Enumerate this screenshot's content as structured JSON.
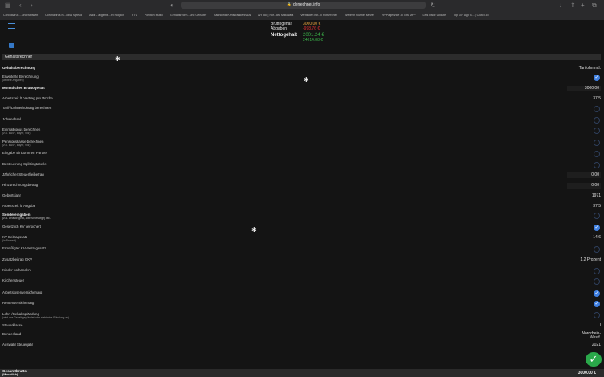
{
  "browser": {
    "url": "derrechner.info",
    "bookmarks": [
      "Coronavirus ...und weltweit",
      "Coronavirus m...lobal spread",
      "Audi – allgeme...tei möglich",
      "FTV",
      "Position Music",
      "Gehaltsrechn...und Gehälter",
      "Zahnklinik Kreiskrankenhaus",
      "Art Idol | Por...dra Makowka",
      "Verbinden mit...Il PowerShell",
      "Webmin tvusnet server",
      "HP PageWide 377dw MFP",
      "LetsTrade Update",
      "Top 10+ App B... | Clutch.co"
    ]
  },
  "summary": {
    "brutto_label": "Bruttogehalt",
    "brutto_value": "3000.00 €",
    "abgaben_label": "Abgaben",
    "abgaben_value": "-998.76 €",
    "netto_label": "Nettogehalt",
    "netto_value": "2001.24 €",
    "netto_sub": "24014.88 €",
    "colors": {
      "brutto": "#e6a23c",
      "abgaben": "#e03030",
      "netto": "#3bb34a"
    }
  },
  "section_title": "Gehaltsrechner",
  "rows": [
    {
      "label": "Gehaltsberechnung",
      "bold": true,
      "value": "Tarifohn mtl."
    },
    {
      "label": "Erweiterte Berechnung",
      "sub": "(weitere Angaben)",
      "check": true
    },
    {
      "label": "Monatliches Bruttogehalt",
      "bold": true,
      "value": "3000.00",
      "boxed": true
    },
    {
      "label": "Arbeitszeit lt. Vertrag pro Woche",
      "value": "37.5"
    },
    {
      "label": "Tarif-/Lohnerhöhung berechnen",
      "check": false
    },
    {
      "label": "Jobwechsel",
      "check": false
    },
    {
      "label": "Einmalbonus berechnen",
      "sub": "(z.B. BASF, Bayer, VW)",
      "check": false
    },
    {
      "label": "Pensionskasse berechnen",
      "sub": "(z.B. BASF, Bayer, VW)",
      "check": false
    },
    {
      "label": "Eingabe Einkommen Partner",
      "check": false
    },
    {
      "label": "Besteuerung Splittingtabelle",
      "check": false
    },
    {
      "label": "Jährlicher Steuerfreibetrag",
      "value": "0.00",
      "boxed": true
    },
    {
      "label": "Hinzurechnungsbetrag",
      "value": "0.00",
      "boxed": true
    },
    {
      "label": "Geburtsjahr",
      "value": "1971"
    },
    {
      "label": "Arbeitszeit lt. Angabe",
      "value": "37.5"
    },
    {
      "label": "Sondereingaben",
      "bold": true,
      "sub": "(z.B. Urlaubsgeld, Altersvorsorge) etc.",
      "check": false
    },
    {
      "label": "Gesetzlich KV versichert",
      "check": true
    },
    {
      "label": "KV-Beitragssatz",
      "sub": "(in Prozent)",
      "value": "14.6"
    },
    {
      "label": "Ermäßigter KV-Beitragssatz",
      "check": false
    },
    {
      "label": "Zusatzbeitrag GKV",
      "value": "1.2 Prozent"
    },
    {
      "label": "Kinder vorhanden",
      "check": false
    },
    {
      "label": "Kirchensteuer",
      "check": false
    },
    {
      "label": "Arbeitslosenversicherung",
      "check": true
    },
    {
      "label": "Rentenversicherung",
      "check": true
    },
    {
      "label": "Lohn-/Gehaltspfändung",
      "sub": "(wird das Gehalt gepfändet oder steht eine Pfändung an)",
      "check": false
    },
    {
      "label": "Steuerklasse",
      "value": "I"
    },
    {
      "label": "Bundesland",
      "value": "Nordrhein-Westf.",
      "two_line": true
    },
    {
      "label": "Auswahl Steuerjahr",
      "value": "2021"
    }
  ],
  "submit_icon": "checkmark-icon",
  "footer": {
    "label": "Gesamtbrutto",
    "sub": "(Monatlich)",
    "value": "3000.00 €"
  }
}
